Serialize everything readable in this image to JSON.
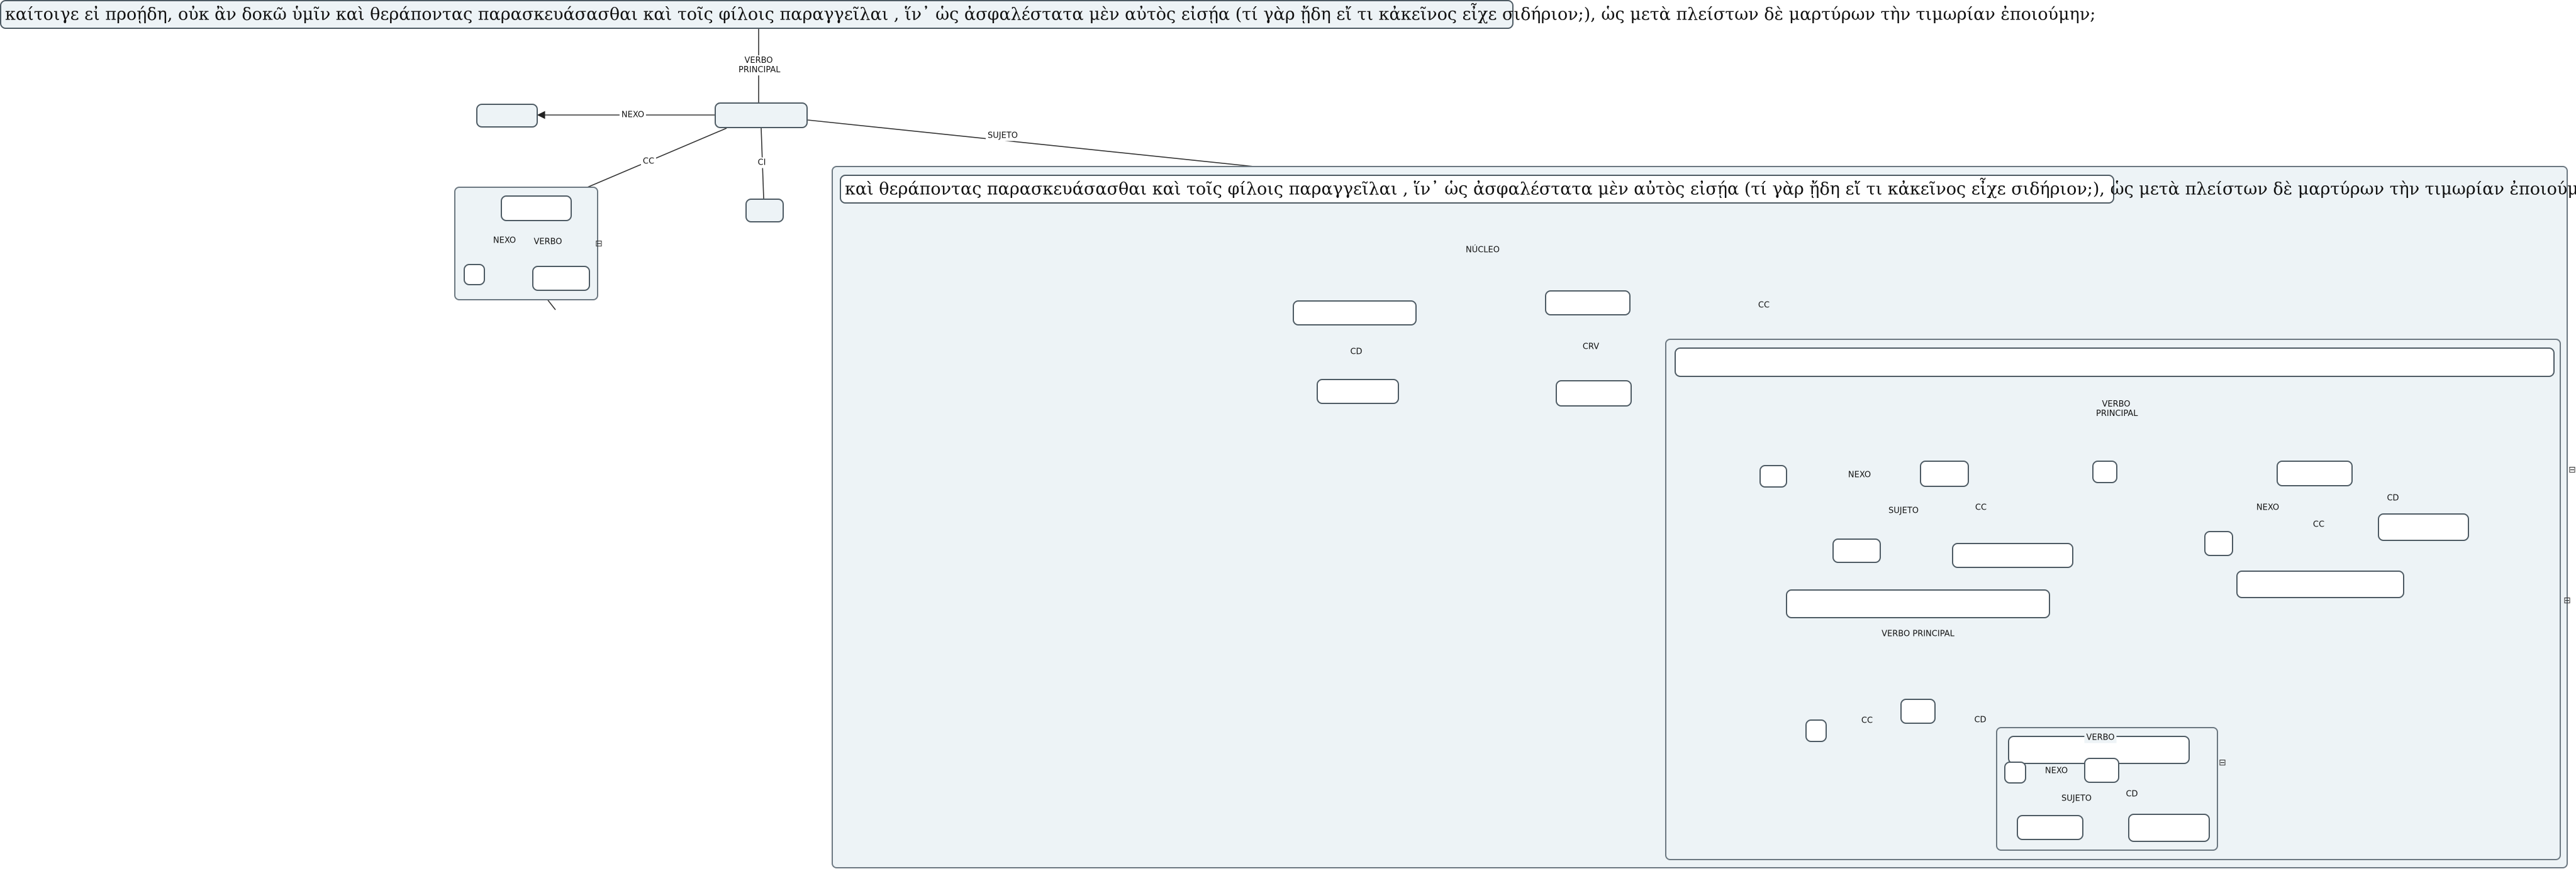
{
  "root_sentence": "καίτοιγε εἰ προῄδη, οὐκ ἂν δοκῶ ὑμῖν καὶ θεράποντας παρασκευάσασθαι καὶ τοῖς φίλοις παραγγεῖλαι , ἵν᾿  ὡς  ἀσφαλέστατα μὲν αὐτὸς εἰσῄα  (τί γὰρ ᾔδη εἴ τι κἀκεῖνος εἶχε σιδήριον;), ὡς μετὰ πλείστων δὲ μαρτύρων τὴν τιμωρίαν ἐποιούμην;",
  "subject_sentence": "καὶ θεράποντας παρασκευάσασθαι καὶ τοῖς φίλοις παραγγεῖλαι , ἵν᾿  ὡς  ἀσφαλέστατα μὲν αὐτὸς εἰσῄα  (τί γὰρ ᾔδη εἴ τι κἀκεῖνος εἶχε σιδήριον;), ὡς μετὰ πλείστων δὲ μαρτύρων τὴν τιμωρίαν ἐποιούμην;",
  "edge_labels": {
    "verbo_principal": "VERBO PRINCIPAL",
    "nexo": "NEXO",
    "sujeto": "SUJETO",
    "cc": "CC",
    "ci": "CI",
    "verbo": "VERBO",
    "nucleo": "NÚCLEO",
    "cd": "CD",
    "crv": "CRV"
  },
  "icons": {
    "collapse": "collapse-icon"
  },
  "colors": {
    "container_fill": "#edf3f6",
    "node_border": "#4d5a63",
    "edge": "#333333"
  }
}
